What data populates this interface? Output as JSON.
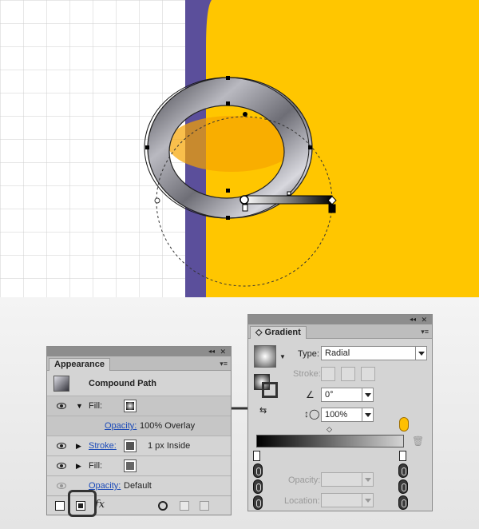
{
  "appearance": {
    "tab": "Appearance",
    "title": "Compound Path",
    "fill_label": "Fill:",
    "opacity_link": "Opacity:",
    "opacity_value": "100% Overlay",
    "stroke_link": "Stroke:",
    "stroke_value": "1 px  Inside",
    "fill2_label": "Fill:",
    "opacity2_link": "Opacity:",
    "opacity2_value": "Default"
  },
  "gradient": {
    "tab": "Gradient",
    "type_label": "Type:",
    "type_value": "Radial",
    "stroke_label": "Stroke:",
    "angle_value": "0°",
    "aspect_value": "100%",
    "opacity_label": "Opacity:",
    "location_label": "Location:"
  },
  "colors": {
    "yellow": "#ffc600",
    "purple": "#5b4f9b",
    "panel": "#d4d4d4",
    "link": "#1c4bb8"
  },
  "icons": [
    "eye-icon",
    "fx-icon",
    "clear-appearance-icon",
    "duplicate-item-icon",
    "trash-icon",
    "gradient-swatch-icon",
    "reverse-gradient-icon",
    "angle-icon",
    "aspect-ratio-icon"
  ]
}
